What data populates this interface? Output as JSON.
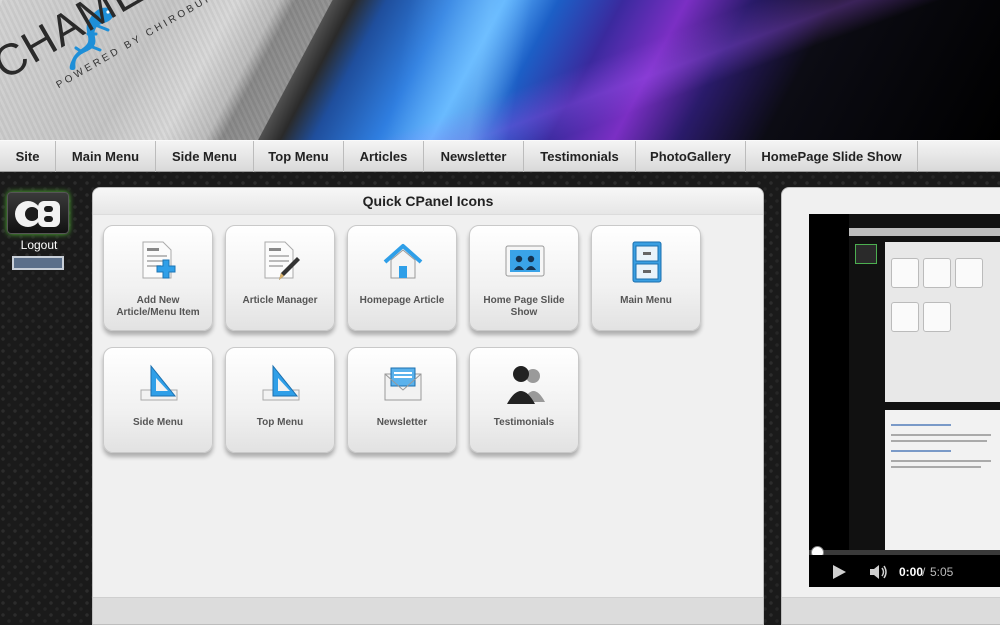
{
  "banner": {
    "logo_text": "CHAMELEON",
    "logo_subtext": "POWERED BY CHIROBUILT"
  },
  "nav": {
    "items": [
      {
        "label": "Site"
      },
      {
        "label": "Main Menu"
      },
      {
        "label": "Side Menu"
      },
      {
        "label": "Top Menu"
      },
      {
        "label": "Articles"
      },
      {
        "label": "Newsletter"
      },
      {
        "label": "Testimonials"
      },
      {
        "label": "PhotoGallery"
      },
      {
        "label": "HomePage Slide Show"
      }
    ]
  },
  "sidebar": {
    "logo_text": "CB",
    "logout_label": "Logout"
  },
  "panel": {
    "title": "Quick CPanel Icons",
    "tiles": [
      {
        "label": "Add New Article/Menu Item",
        "icon": "add-article-icon"
      },
      {
        "label": "Article Manager",
        "icon": "article-edit-icon"
      },
      {
        "label": "Homepage Article",
        "icon": "home-icon"
      },
      {
        "label": "Home Page Slide Show",
        "icon": "slideshow-icon"
      },
      {
        "label": "Main Menu",
        "icon": "cabinet-icon"
      },
      {
        "label": "Side Menu",
        "icon": "triangle-ruler-icon"
      },
      {
        "label": "Top Menu",
        "icon": "triangle-ruler-icon"
      },
      {
        "label": "Newsletter",
        "icon": "envelope-icon"
      },
      {
        "label": "Testimonials",
        "icon": "users-icon"
      }
    ]
  },
  "video": {
    "current_time": "0:00",
    "separator": "/",
    "duration": "5:05",
    "progress": 0
  },
  "colors": {
    "accent_blue": "#2f7ee0",
    "nav_bg": "#e6e6e6",
    "panel_bg": "#f0f0f0",
    "logout_button": "#5b6f8a"
  }
}
